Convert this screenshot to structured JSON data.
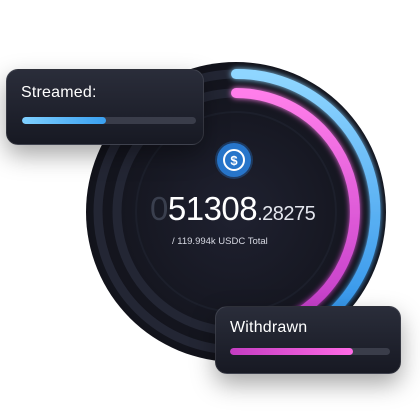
{
  "coin": {
    "icon": "usdc-icon",
    "glyph": "$",
    "color": "#2775ca"
  },
  "amount": {
    "leading": "0",
    "integer": "51308",
    "decimal": ".28275"
  },
  "total_label": "/ 119.994k USDC Total",
  "streamed": {
    "label": "Streamed:",
    "progress": 0.48,
    "color": "#3aa0f0"
  },
  "withdrawn": {
    "label": "Withdrawn",
    "progress": 0.77,
    "color": "#e84fe0"
  },
  "rings": {
    "outer_color": "#3aa0f0",
    "inner_color": "#e84fe0",
    "background": "#171923"
  }
}
